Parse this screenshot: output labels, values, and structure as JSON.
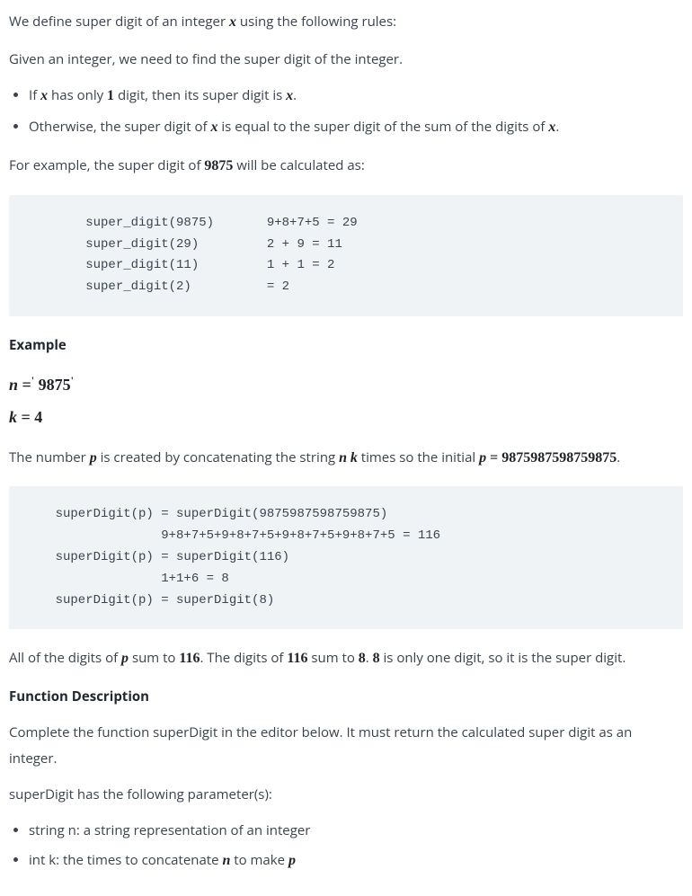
{
  "intro": {
    "p1_a": "We define super digit of an integer ",
    "p1_x": "x",
    "p1_b": " using the following rules:",
    "p2": "Given an integer, we need to find the super digit of the integer.",
    "bullet1_a": "If ",
    "bullet1_x": "x",
    "bullet1_b": " has only ",
    "bullet1_one": "1",
    "bullet1_c": " digit, then its super digit is ",
    "bullet1_x2": "x",
    "bullet1_d": ".",
    "bullet2_a": "Otherwise, the super digit of ",
    "bullet2_x": "x",
    "bullet2_b": " is equal to the super digit of the sum of the digits of ",
    "bullet2_x2": "x",
    "bullet2_c": ".",
    "p3_a": "For example, the super digit of ",
    "p3_num": "9875",
    "p3_b": " will be calculated as:"
  },
  "code1": "\tsuper_digit(9875)   \t9+8+7+5 = 29 \n\tsuper_digit(29) \t2 + 9 = 11\n\tsuper_digit(11)\t\t1 + 1 = 2\n\tsuper_digit(2)\t\t= 2  ",
  "example": {
    "heading": "Example",
    "eq1_lhs": "n",
    "eq1_eq": " =",
    "eq1_prime1": "'",
    "eq1_sp": " ",
    "eq1_rhs": "9875",
    "eq1_prime2": "'",
    "eq2_lhs": "k",
    "eq2_eq": " = ",
    "eq2_rhs": "4",
    "p_a": "The number ",
    "p_pvar": "p",
    "p_b": " is created by concatenating the string ",
    "p_nvar": "n",
    "p_sp": " ",
    "p_kvar": "k",
    "p_c": " times so the initial ",
    "p_pvar2": "p",
    "p_eq": " = ",
    "p_val": "9875987598759875",
    "p_d": "."
  },
  "code2": "    superDigit(p) = superDigit(9875987598759875)\n                  9+8+7+5+9+8+7+5+9+8+7+5+9+8+7+5 = 116\n    superDigit(p) = superDigit(116)\n                  1+1+6 = 8\n    superDigit(p) = superDigit(8)",
  "after": {
    "p_a": "All of the digits of ",
    "p_pvar": "p",
    "p_b": " sum to ",
    "p_116": "116",
    "p_c": ". The digits of ",
    "p_116b": "116",
    "p_d": " sum to ",
    "p_8": "8",
    "p_e": ". ",
    "p_8b": "8",
    "p_f": " is only one digit, so it is the super digit."
  },
  "funcdesc": {
    "heading": "Function Description",
    "p1": "Complete the function superDigit in the editor below. It must return the calculated super digit as an integer.",
    "p2": "superDigit has the following parameter(s):",
    "bullet1": "string n: a string representation of an integer",
    "bullet2_a": "int k: the times to concatenate ",
    "bullet2_n": "n",
    "bullet2_b": " to make ",
    "bullet2_p": "p"
  }
}
